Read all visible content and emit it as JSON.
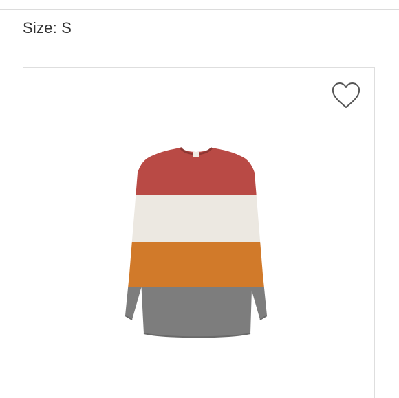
{
  "product": {
    "size_text": "Size: S"
  },
  "icons": {
    "favorite": "heart-outline-icon"
  },
  "colors": {
    "stripe_rust": "#b94a45",
    "stripe_cream": "#ece8e1",
    "stripe_orange": "#d17a2a",
    "stripe_gray": "#7d7d7d",
    "card_border": "#dedede",
    "heart_stroke": "#555555"
  }
}
